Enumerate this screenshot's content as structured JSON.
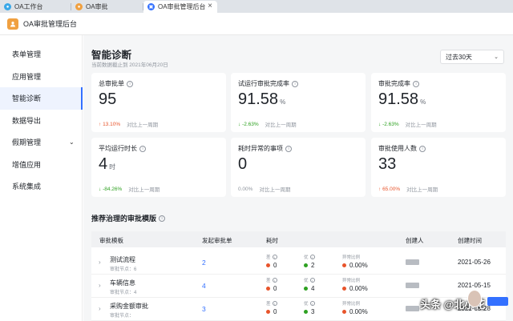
{
  "tabs": [
    {
      "label": "OA工作台",
      "color": "#3aa8e8"
    },
    {
      "label": "OA审批",
      "color": "#f0a040"
    },
    {
      "label": "OA审批管理后台",
      "color": "#3370ff"
    }
  ],
  "header": {
    "title": "OA审批管理后台"
  },
  "sidebar": {
    "items": [
      {
        "label": "表单管理"
      },
      {
        "label": "应用管理"
      },
      {
        "label": "智能诊断"
      },
      {
        "label": "数据导出"
      },
      {
        "label": "假期管理"
      },
      {
        "label": "增值应用"
      },
      {
        "label": "系统集成"
      }
    ]
  },
  "page": {
    "title": "智能诊断",
    "subtitle": "当前数据截止到 2021年06月20日",
    "range": "过去30天"
  },
  "cards": [
    {
      "title": "总审批单",
      "value": "95",
      "unit": "",
      "trend": "13.10%",
      "dir": "up",
      "compare": "对比上一周期"
    },
    {
      "title": "试运行审批完成率",
      "value": "91.58",
      "unit": "%",
      "trend": "-2.63%",
      "dir": "down",
      "compare": "对比上一周期"
    },
    {
      "title": "审批完成率",
      "value": "91.58",
      "unit": "%",
      "trend": "-2.63%",
      "dir": "down",
      "compare": "对比上一周期"
    },
    {
      "title": "平均运行时长",
      "value": "4",
      "unit": "时",
      "trend": "-84.26%",
      "dir": "down",
      "compare": "对比上一周期"
    },
    {
      "title": "耗时异常的事项",
      "value": "0",
      "unit": "",
      "trend": "0.00%",
      "dir": "flat",
      "compare": "对比上一周期"
    },
    {
      "title": "审批使用人数",
      "value": "33",
      "unit": "",
      "trend": "65.00%",
      "dir": "up",
      "compare": "对比上一周期"
    }
  ],
  "section": {
    "title": "推荐治理的审批模版"
  },
  "table": {
    "headers": {
      "template": "审批模板",
      "count": "发起审批单",
      "duration": "耗时",
      "creator": "创建人",
      "created": "创建时间"
    },
    "sub_labels": {
      "bad": "差",
      "good": "优",
      "ratio": "异常比例"
    },
    "rows": [
      {
        "name": "测试流程",
        "nodes": "审批节点：6",
        "count": "2",
        "bad": "0",
        "good": "2",
        "ratio": "0.00%",
        "date": "2021-05-26"
      },
      {
        "name": "车辆信息",
        "nodes": "审批节点：4",
        "count": "4",
        "bad": "0",
        "good": "4",
        "ratio": "0.00%",
        "date": "2021-05-15"
      },
      {
        "name": "采购金额审批",
        "nodes": "审批节点：",
        "count": "3",
        "bad": "0",
        "good": "3",
        "ratio": "0.00%",
        "date": "2021-05-28"
      }
    ]
  },
  "watermark": {
    "text": "头条 @北小花"
  },
  "colors": {
    "accent": "#3370ff",
    "up": "#e8542b",
    "down": "#2ea121",
    "bad_dot": "#e8542b",
    "good_dot": "#2ea121"
  }
}
